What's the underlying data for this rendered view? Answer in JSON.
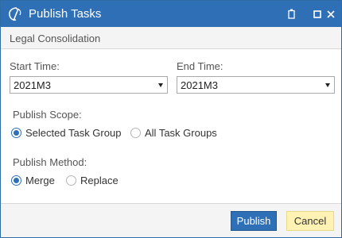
{
  "window": {
    "title": "Publish Tasks",
    "logo_icon": "app-logo-icon",
    "controls": [
      "restore-icon",
      "maximize-icon",
      "close-icon"
    ]
  },
  "subheader": {
    "text": "Legal Consolidation"
  },
  "form": {
    "start_time": {
      "label": "Start Time:",
      "value": "2021M3"
    },
    "end_time": {
      "label": "End Time:",
      "value": "2021M3"
    },
    "publish_scope": {
      "label": "Publish Scope:",
      "options": [
        {
          "label": "Selected Task Group",
          "checked": true
        },
        {
          "label": "All Task Groups",
          "checked": false
        }
      ]
    },
    "publish_method": {
      "label": "Publish Method:",
      "options": [
        {
          "label": "Merge",
          "checked": true
        },
        {
          "label": "Replace",
          "checked": false
        }
      ]
    }
  },
  "footer": {
    "publish_label": "Publish",
    "cancel_label": "Cancel"
  },
  "colors": {
    "accent": "#2f6fb5",
    "cancel_bg": "#fff2b3"
  }
}
